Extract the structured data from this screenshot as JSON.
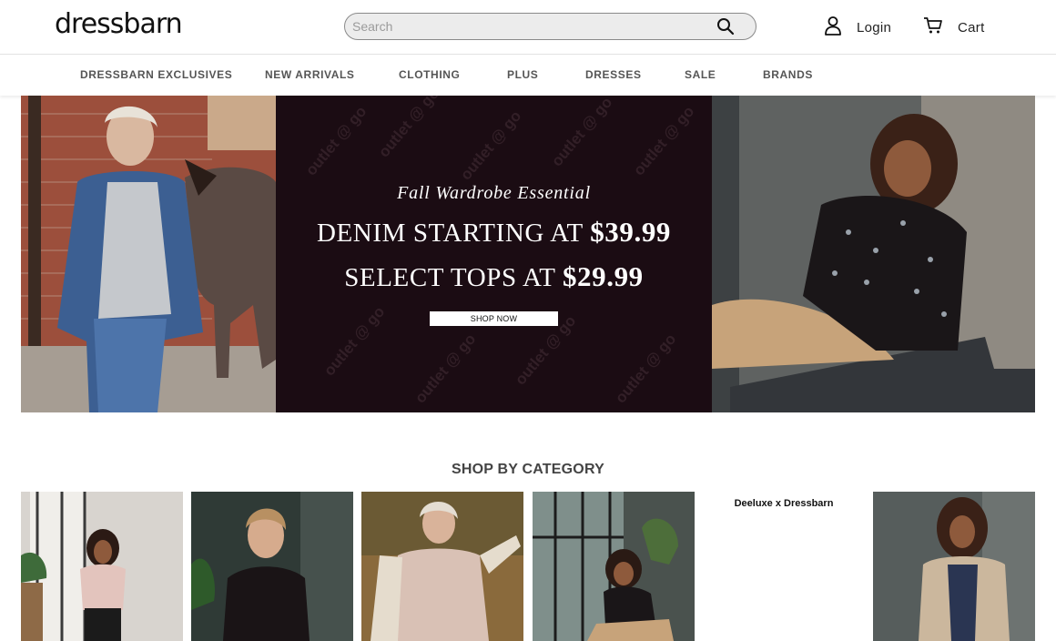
{
  "header": {
    "logo": "dressbarn",
    "search_placeholder": "Search",
    "login_label": "Login",
    "cart_label": "Cart"
  },
  "nav": {
    "items": [
      "DRESSBARN EXCLUSIVES",
      "NEW ARRIVALS",
      "CLOTHING",
      "PLUS",
      "DRESSES",
      "SALE",
      "BRANDS"
    ]
  },
  "hero": {
    "kicker": "Fall Wardrobe Essential",
    "line1_text": "DENIM STARTING AT",
    "line1_price": "$39.99",
    "line2_text": "SELECT TOPS AT",
    "line2_price": "$29.99",
    "cta": "SHOP NOW",
    "watermark": "outlet @ go"
  },
  "category": {
    "title": "SHOP BY CATEGORY",
    "text_tile": "Deeluxe x Dressbarn"
  },
  "colors": {
    "hero_panel": "#1b0c13",
    "nav_text": "#555555",
    "search_bg": "#ececec"
  }
}
